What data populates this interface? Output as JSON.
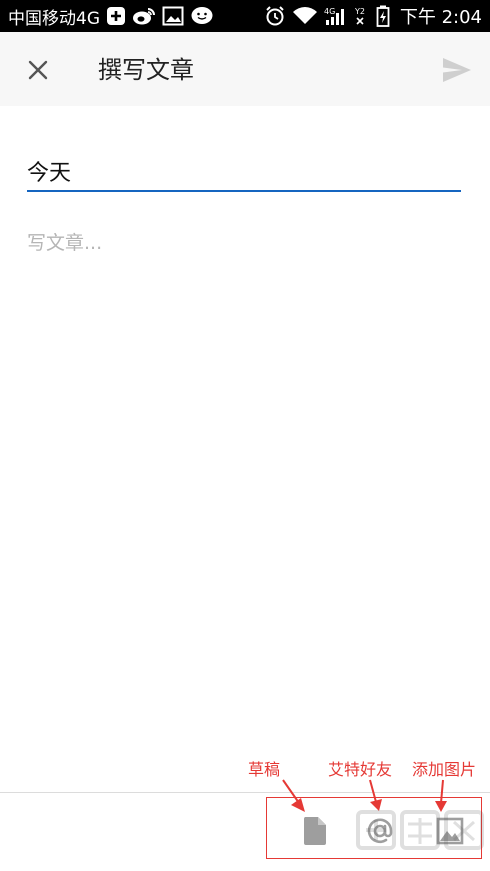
{
  "status_bar": {
    "carrier": "中国移动4G",
    "time": "下午 2:04",
    "sim_label": "2",
    "network_label": "4G"
  },
  "header": {
    "title": "撰写文章",
    "close_icon": "close-icon",
    "send_icon": "send-icon"
  },
  "editor": {
    "title_value": "今天",
    "body_placeholder": "写文章..."
  },
  "toolbar": {
    "draft_icon": "document-icon",
    "mention_icon": "at-icon",
    "image_icon": "image-icon"
  },
  "annotations": {
    "draft_label": "草稿",
    "mention_label": "艾特好友",
    "image_label": "添加图片"
  },
  "colors": {
    "accent": "#1565c0",
    "annotation": "#e53935",
    "icon_gray": "#9e9e9e",
    "header_bg": "#f7f7f7"
  }
}
